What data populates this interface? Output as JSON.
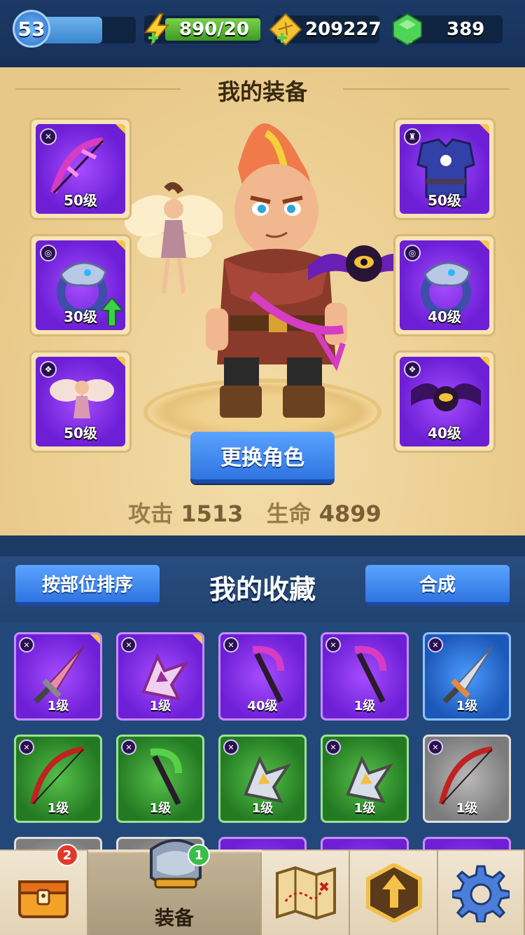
{
  "topbar": {
    "level": "53",
    "xp_fraction": 0.64,
    "energy": "890/20",
    "gold": "209227",
    "gems": "389"
  },
  "equipment": {
    "title": "我的装备",
    "slots": [
      {
        "level": "50级",
        "type": "weapon"
      },
      {
        "level": "30级",
        "type": "ring",
        "upgrade": true
      },
      {
        "level": "50级",
        "type": "pet"
      },
      {
        "level": "50级",
        "type": "armor"
      },
      {
        "level": "40级",
        "type": "ring"
      },
      {
        "level": "40级",
        "type": "pet"
      }
    ],
    "change_button": "更换角色",
    "attack_label": "攻击",
    "attack_value": "1513",
    "hp_label": "生命",
    "hp_value": "4899"
  },
  "collection": {
    "sort_button": "按部位排序",
    "title": "我的收藏",
    "merge_button": "合成",
    "items": [
      {
        "level": "1级",
        "rarity": "purple",
        "icon": "sword-icon"
      },
      {
        "level": "1级",
        "rarity": "purple",
        "icon": "boomerang-icon"
      },
      {
        "level": "40级",
        "rarity": "purple",
        "icon": "scythe-icon"
      },
      {
        "level": "1级",
        "rarity": "purple",
        "icon": "scythe-icon"
      },
      {
        "level": "1级",
        "rarity": "blue",
        "icon": "sword-icon"
      },
      {
        "level": "1级",
        "rarity": "green",
        "icon": "bow-icon"
      },
      {
        "level": "1级",
        "rarity": "green",
        "icon": "scythe-icon"
      },
      {
        "level": "1级",
        "rarity": "green",
        "icon": "boomerang-icon"
      },
      {
        "level": "1级",
        "rarity": "green",
        "icon": "boomerang-icon"
      },
      {
        "level": "1级",
        "rarity": "gray",
        "icon": "bow-icon"
      }
    ]
  },
  "nav": {
    "chest_badge": "2",
    "equip_badge": "1",
    "equip_label": "装备"
  }
}
